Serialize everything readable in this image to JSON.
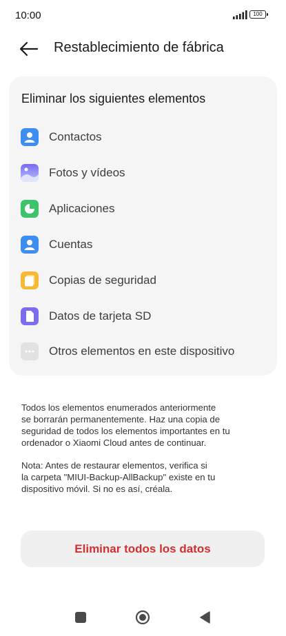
{
  "status_bar": {
    "time": "10:00",
    "battery": "100"
  },
  "header": {
    "title": "Restablecimiento de fábrica"
  },
  "card": {
    "title": "Eliminar los siguientes elementos",
    "items": [
      {
        "label": "Contactos",
        "icon": "contact-icon",
        "color": "#3d8ef0"
      },
      {
        "label": "Fotos y vídeos",
        "icon": "gallery-icon",
        "color": "#8c7cf0"
      },
      {
        "label": "Aplicaciones",
        "icon": "apps-icon",
        "color": "#3dc46b"
      },
      {
        "label": "Cuentas",
        "icon": "account-icon",
        "color": "#3d8ef0"
      },
      {
        "label": "Copias de seguridad",
        "icon": "backup-icon",
        "color": "#f5b935"
      },
      {
        "label": "Datos de tarjeta SD",
        "icon": "sd-card-icon",
        "color": "#7b6cf0"
      },
      {
        "label": "Otros elementos en este dispositivo",
        "icon": "more-icon",
        "color": "#e2e2e2"
      }
    ]
  },
  "notice": {
    "paragraph1": "Todos los elementos enumerados anteriormente\nse borrarán permanentemente. Haz una copia de\nseguridad de todos los elementos importantes en tu\nordenador o Xiaomi Cloud antes de continuar.",
    "paragraph2": "Nota: Antes de restaurar elementos, verifica si\nla carpeta \"MIUI-Backup-AllBackup\" existe en tu\ndispositivo móvil. Si no es así, créala."
  },
  "action": {
    "erase_label": "Eliminar todos los datos",
    "color": "#d32f2f"
  }
}
